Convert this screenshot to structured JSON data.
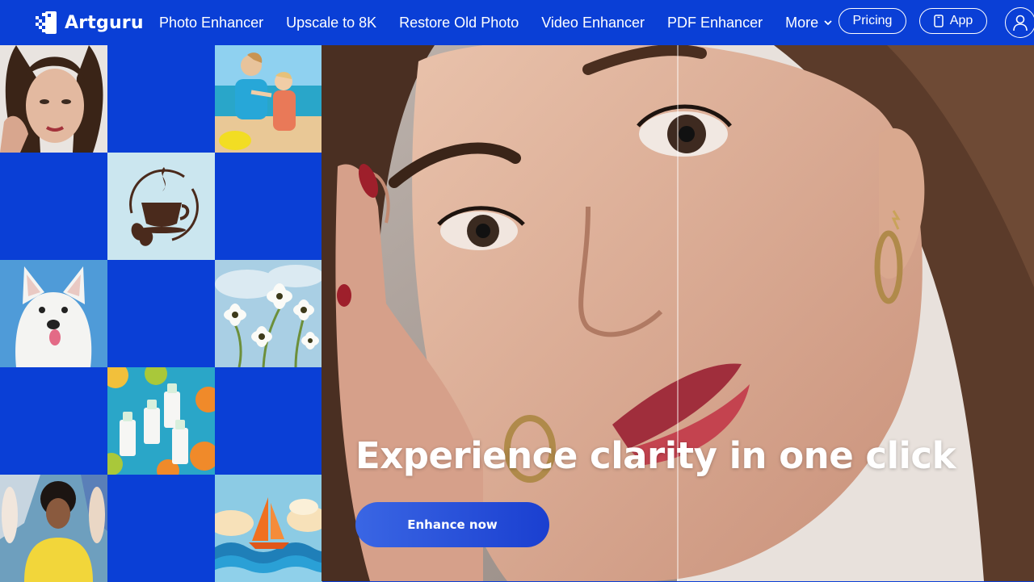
{
  "brand": {
    "name": "Artguru"
  },
  "nav": {
    "links": [
      "Photo Enhancer",
      "Upscale to 8K",
      "Restore Old Photo",
      "Video Enhancer",
      "PDF Enhancer"
    ],
    "more_label": "More",
    "pricing_label": "Pricing",
    "app_label": "App"
  },
  "hero": {
    "title": "Experience clarity in one click",
    "cta_label": "Enhance now"
  },
  "icons": [
    "logo-icon",
    "chevron-down-icon",
    "phone-icon",
    "user-icon"
  ],
  "colors": {
    "brand_blue": "#0a3fd6",
    "cta_start": "#3a66e4",
    "cta_end": "#1a3fd0"
  }
}
